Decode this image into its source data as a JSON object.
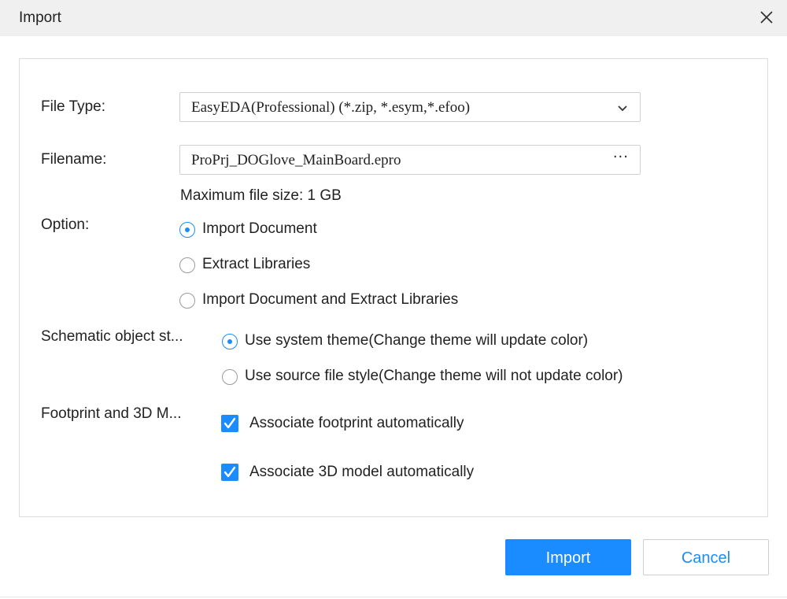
{
  "dialog": {
    "title": "Import",
    "close_icon": "close-icon"
  },
  "form": {
    "file_type": {
      "label": "File Type:",
      "value": "EasyEDA(Professional) (*.zip, *.esym,*.efoo)",
      "icon": "chevron-down-icon"
    },
    "filename": {
      "label": "Filename:",
      "value": "ProPrj_DOGlove_MainBoard.epro",
      "browse_label": "···"
    },
    "max_size_note": "Maximum file size: 1 GB",
    "option": {
      "label": "Option:",
      "items": [
        {
          "label": "Import Document",
          "checked": true
        },
        {
          "label": "Extract Libraries",
          "checked": false
        },
        {
          "label": "Import Document and Extract Libraries",
          "checked": false
        }
      ]
    },
    "schematic_style": {
      "label": "Schematic object st...",
      "items": [
        {
          "label": "Use system theme(Change theme will update color)",
          "checked": true
        },
        {
          "label": "Use source file style(Change theme will not update color)",
          "checked": false
        }
      ]
    },
    "footprint_3d": {
      "label": "Footprint and 3D M...",
      "items": [
        {
          "label": "Associate footprint automatically",
          "checked": true
        },
        {
          "label": "Associate 3D model automatically",
          "checked": true
        }
      ]
    }
  },
  "buttons": {
    "import_label": "Import",
    "cancel_label": "Cancel"
  },
  "colors": {
    "accent": "#1a8cff",
    "titlebar_bg": "#f0f0f0",
    "border": "#dcdcdc"
  }
}
